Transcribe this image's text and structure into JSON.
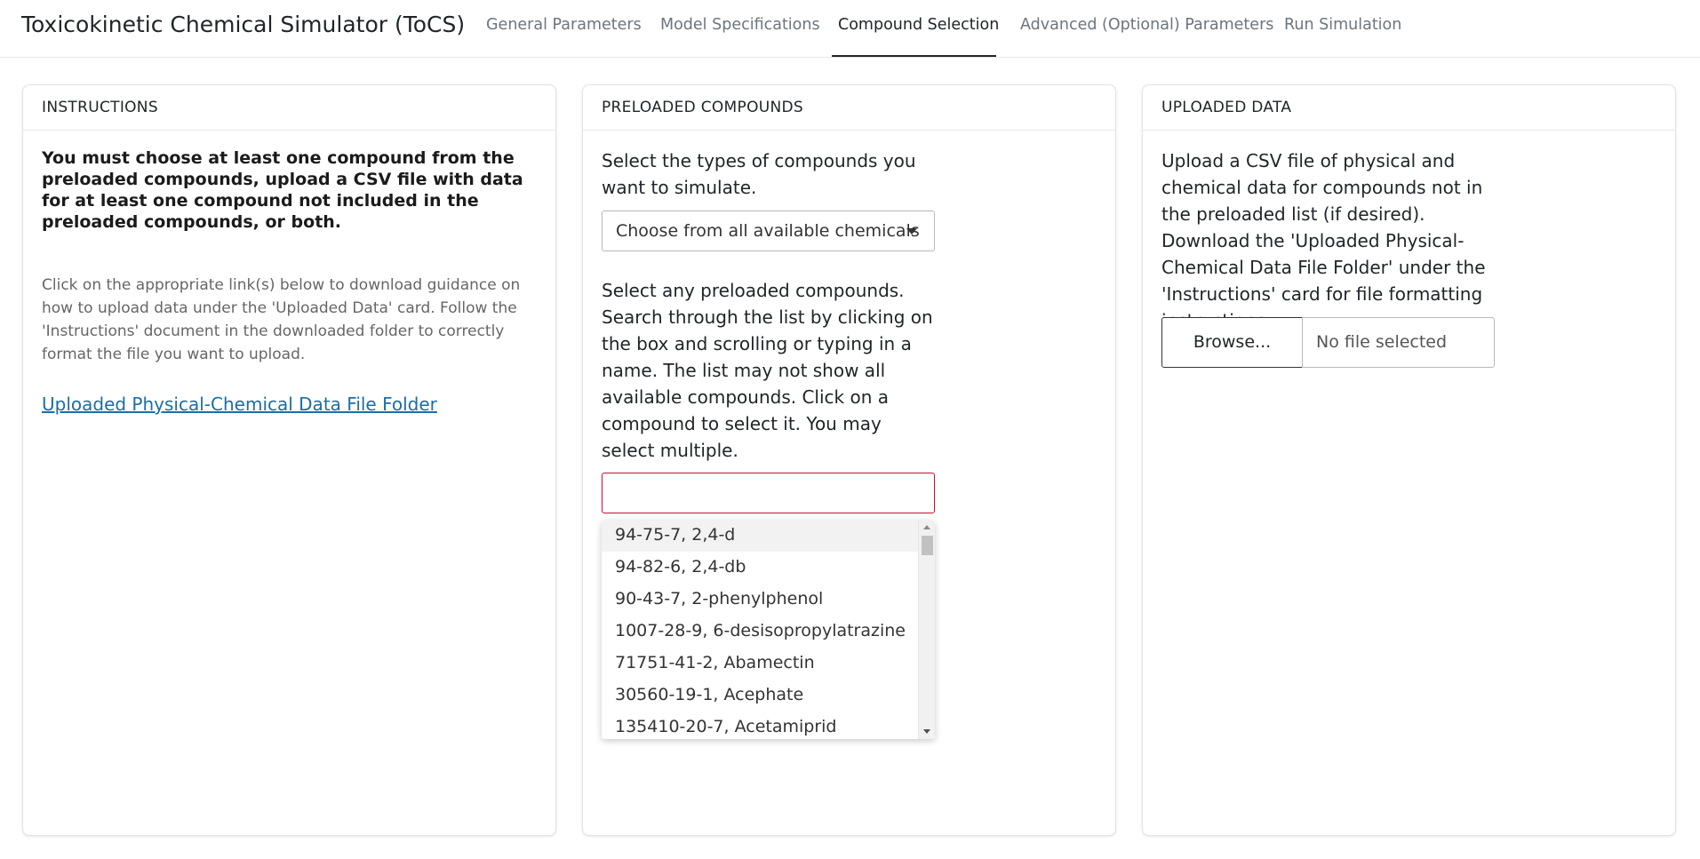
{
  "app": {
    "title": "Toxicokinetic Chemical Simulator (ToCS)"
  },
  "nav": {
    "tabs": [
      {
        "label": "General Parameters",
        "active": false
      },
      {
        "label": "Model Specifications",
        "active": false
      },
      {
        "label": "Compound Selection",
        "active": true
      },
      {
        "label": "Advanced (Optional) Parameters",
        "active": false
      },
      {
        "label": "Run Simulation",
        "active": false
      }
    ]
  },
  "instructions_card": {
    "header": "INSTRUCTIONS",
    "bold_text": "You must choose at least one compound from the preloaded compounds, upload a CSV file with data for at least one compound not included in the preloaded compounds, or both.",
    "body_text": "Click on the appropriate link(s) below to download guidance on how to upload data under the 'Uploaded Data' card. Follow the 'Instructions' document in the downloaded folder to correctly format the file you want to upload.",
    "link_text": "Uploaded Physical-Chemical Data File Folder"
  },
  "preloaded_card": {
    "header": "PRELOADED COMPOUNDS",
    "type_prompt": "Select the types of compounds you want to simulate.",
    "type_select_value": "Choose from all available chemicals",
    "compounds_prompt": "Select any preloaded compounds. Search through the list by clicking on the box and scrolling or typing in a name. The list may not show all available compounds. Click on a compound to select it. You may select multiple.",
    "search_value": "",
    "options": [
      "94-75-7, 2,4-d",
      "94-82-6, 2,4-db",
      "90-43-7, 2-phenylphenol",
      "1007-28-9, 6-desisopropylatrazine",
      "71751-41-2, Abamectin",
      "30560-19-1, Acephate",
      "135410-20-7, Acetamiprid"
    ]
  },
  "uploaded_card": {
    "header": "UPLOADED DATA",
    "body_text": "Upload a CSV file of physical and chemical data for compounds not in the preloaded list (if desired). Download the 'Uploaded Physical-Chemical Data File Folder' under the 'Instructions' card for file formatting instructions.",
    "browse_label": "Browse...",
    "file_status": "No file selected"
  },
  "colors": {
    "link": "#1a6ea8",
    "invalid_border": "#c8102e",
    "active_tab": "#212529",
    "inactive_tab": "#6c757d"
  }
}
